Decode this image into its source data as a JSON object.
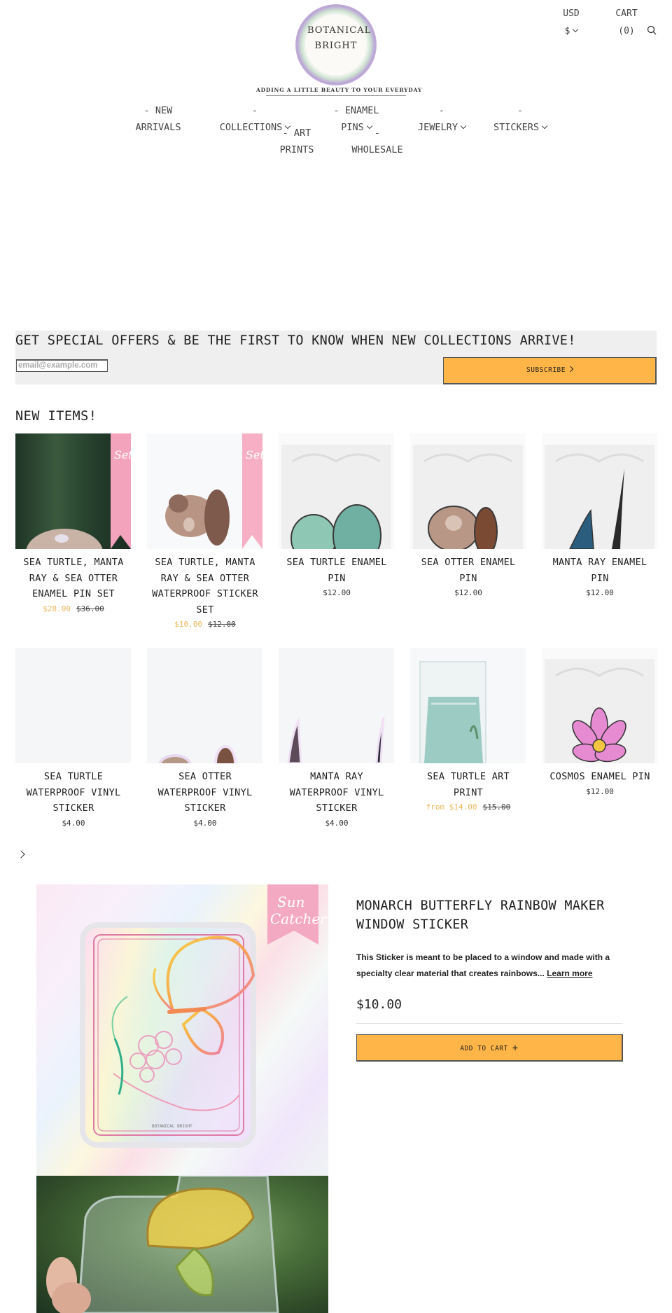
{
  "header": {
    "logo_line1": "BOTANICAL",
    "logo_line2": "BRIGHT",
    "tagline": "ADDING A LITTLE BEAUTY TO YOUR EVERYDAY",
    "currency": "USD",
    "currency_symbol": "$",
    "cart_label": "CART",
    "cart_count": "(0)"
  },
  "nav": {
    "new_arrivals_1": "- NEW",
    "new_arrivals_2": "ARRIVALS",
    "collections_1": "-",
    "collections_2": "COLLECTIONS",
    "enamel_1": "- ENAMEL",
    "enamel_2": "PINS",
    "jewelry_1": "-",
    "jewelry_2": "JEWELRY",
    "stickers_1": "-",
    "stickers_2": "STICKERS",
    "art_1": "- ART",
    "art_2": "PRINTS",
    "wholesale_1": "-",
    "wholesale_2": "WHOLESALE"
  },
  "newsletter": {
    "heading": "GET SPECIAL OFFERS & BE THE FIRST TO KNOW WHEN NEW COLLECTIONS ARRIVE!",
    "placeholder": "email@example.com",
    "button": "SUBSCRIBE"
  },
  "new_items": {
    "title": "NEW ITEMS!",
    "products": [
      {
        "name": "SEA TURTLE, MANTA RAY & SEA OTTER ENAMEL PIN SET",
        "price": "$28.00",
        "compare": "$36.00"
      },
      {
        "name": "SEA TURTLE, MANTA RAY & SEA OTTER WATERPROOF STICKER SET",
        "price": "$10.00",
        "compare": "$12.00"
      },
      {
        "name": "SEA TURTLE ENAMEL PIN",
        "price": "$12.00"
      },
      {
        "name": "SEA OTTER ENAMEL PIN",
        "price": "$12.00"
      },
      {
        "name": "MANTA RAY ENAMEL PIN",
        "price": "$12.00"
      },
      {
        "name": "SEA TURTLE WATERPROOF VINYL STICKER",
        "price": "$4.00"
      },
      {
        "name": "SEA OTTER WATERPROOF VINYL STICKER",
        "price": "$4.00"
      },
      {
        "name": "MANTA RAY WATERPROOF VINYL STICKER",
        "price": "$4.00"
      },
      {
        "name": "SEA TURTLE ART PRINT",
        "price": "from $14.00",
        "compare": "$15.00"
      },
      {
        "name": "COSMOS ENAMEL PIN",
        "price": "$12.00"
      }
    ]
  },
  "featured": {
    "title": "MONARCH BUTTERFLY RAINBOW MAKER WINDOW STICKER",
    "description": " This Sticker is meant to be placed to a window and made with a specialty clear material that creates rainbows... ",
    "learn_more": "Learn more",
    "price": "$10.00",
    "add_to_cart": "ADD TO CART",
    "badge_line1": "Sun",
    "badge_line2": "Catcher",
    "sticker_brand": "BOTANICAL BRIGHT"
  },
  "colors": {
    "accent_button": "#ffb547",
    "sale_price": "#e9b85c",
    "newsletter_bg": "#efefef"
  }
}
